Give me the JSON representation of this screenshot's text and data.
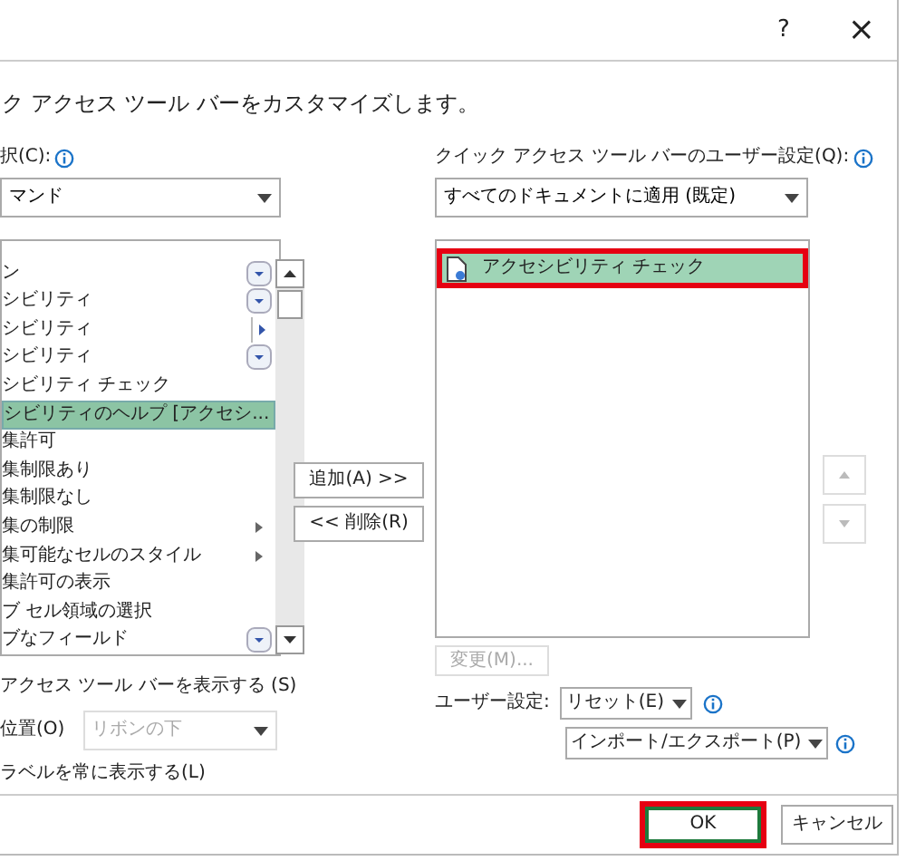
{
  "title_bar": {
    "help": "?",
    "close": "×"
  },
  "description": "ク アクセス ツール バーをカスタマイズします。",
  "commands_from": {
    "label": "択(C):",
    "value": "マンド"
  },
  "commands": [
    {
      "label": "ン",
      "kind": "dropdown",
      "selected": false
    },
    {
      "label": "シビリティ",
      "kind": "dropdown",
      "selected": false
    },
    {
      "label": "シビリティ",
      "kind": "split",
      "selected": false
    },
    {
      "label": "シビリティ",
      "kind": "dropdown",
      "selected": false
    },
    {
      "label": "シビリティ チェック",
      "kind": "plain",
      "selected": false
    },
    {
      "label": "シビリティのヘルプ [アクセシ...",
      "kind": "plain",
      "selected": true
    },
    {
      "label": "集許可",
      "kind": "plain",
      "selected": false
    },
    {
      "label": "集制限あり",
      "kind": "plain",
      "selected": false
    },
    {
      "label": "集制限なし",
      "kind": "plain",
      "selected": false
    },
    {
      "label": "集の制限",
      "kind": "submenu",
      "selected": false
    },
    {
      "label": "集可能なセルのスタイル",
      "kind": "submenu",
      "selected": false
    },
    {
      "label": "集許可の表示",
      "kind": "plain",
      "selected": false
    },
    {
      "label": "ブ セル領域の選択",
      "kind": "plain",
      "selected": false
    },
    {
      "label": "ブなフィールド",
      "kind": "dropdown",
      "selected": false
    }
  ],
  "add_button": "追加(A) >>",
  "remove_button": "<< 削除(R)",
  "show_toolbar": "アクセス ツール バーを表示する (S)",
  "position": {
    "label": "位置(O)",
    "value": "リボンの下",
    "disabled": true
  },
  "always_labels": "ラベルを常に表示する(L)",
  "customize_for": {
    "label": "クイック アクセス ツール バーのユーザー設定(Q):",
    "value": "すべてのドキュメントに適用 (既定)"
  },
  "toolbar_items": [
    {
      "label": "アクセシビリティ チェック",
      "selected": true,
      "highlighted": true
    }
  ],
  "modify_button": {
    "label": "変更(M)...",
    "disabled": true
  },
  "customizations": {
    "label": "ユーザー設定:",
    "reset": "リセット(E)",
    "import_export": "インポート/エクスポート(P)"
  },
  "ok_button": {
    "label": "OK",
    "highlighted": true
  },
  "cancel_button": "キャンセル"
}
